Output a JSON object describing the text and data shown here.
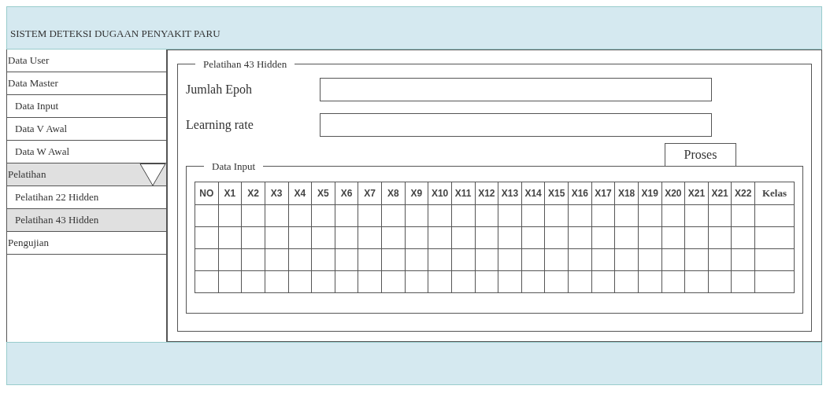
{
  "header": {
    "title": "SISTEM DETEKSI DUGAAN PENYAKIT PARU"
  },
  "sidebar": {
    "items": [
      {
        "label": "Data User",
        "selected": false
      },
      {
        "label": "Data Master",
        "selected": false,
        "children": [
          {
            "label": "Data Input",
            "selected": false
          },
          {
            "label": "Data V Awal",
            "selected": false
          },
          {
            "label": "Data W Awal",
            "selected": false
          }
        ]
      },
      {
        "label": "Pelatihan",
        "selected": true,
        "children": [
          {
            "label": "Pelatihan 22 Hidden",
            "selected": false
          },
          {
            "label": "Pelatihan 43 Hidden",
            "selected": true
          }
        ]
      },
      {
        "label": "Pengujian",
        "selected": false
      }
    ]
  },
  "panel": {
    "title": "Pelatihan 43 Hidden",
    "fields": [
      {
        "label": "Jumlah Epoh"
      },
      {
        "label": "Learning rate"
      }
    ],
    "button": "Proses",
    "data_input": {
      "title": "Data Input",
      "columns": [
        "NO",
        "X1",
        "X2",
        "X3",
        "X4",
        "X5",
        "X6",
        "X7",
        "X8",
        "X9",
        "X10",
        "X11",
        "X12",
        "X13",
        "X14",
        "X15",
        "X16",
        "X17",
        "X18",
        "X19",
        "X20",
        "X21",
        "X21",
        "X22",
        "Kelas"
      ]
    }
  }
}
